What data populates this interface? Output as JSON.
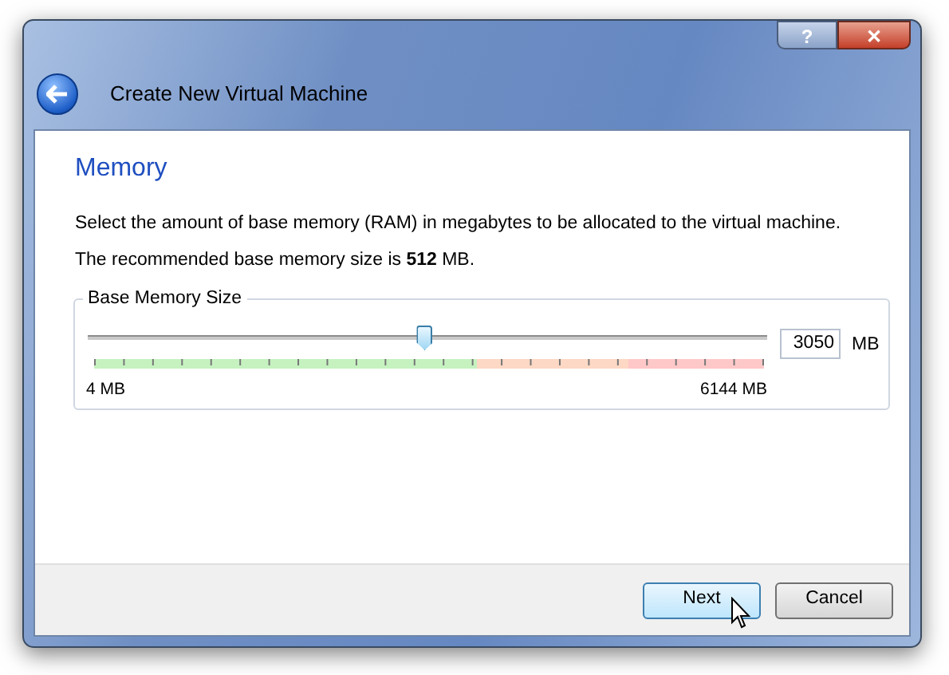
{
  "window": {
    "title": "Create New Virtual Machine",
    "controls": [
      "?",
      "✕"
    ]
  },
  "page": {
    "heading": "Memory",
    "description": "Select the amount of base memory (RAM) in megabytes to be allocated to the virtual machine.",
    "recommendation": "The recommended base memory size is **512** MB."
  },
  "memory_group": {
    "title": "Base Memory Size",
    "slider": {
      "level": 0.496
    },
    "value": "3050",
    "unit": "MB",
    "min_label": "4 MB",
    "max_label": "6144 MB"
  },
  "buttons": [
    {
      "label": "Next",
      "focused": true
    },
    {
      "label": "Cancel",
      "focused": false
    }
  ]
}
